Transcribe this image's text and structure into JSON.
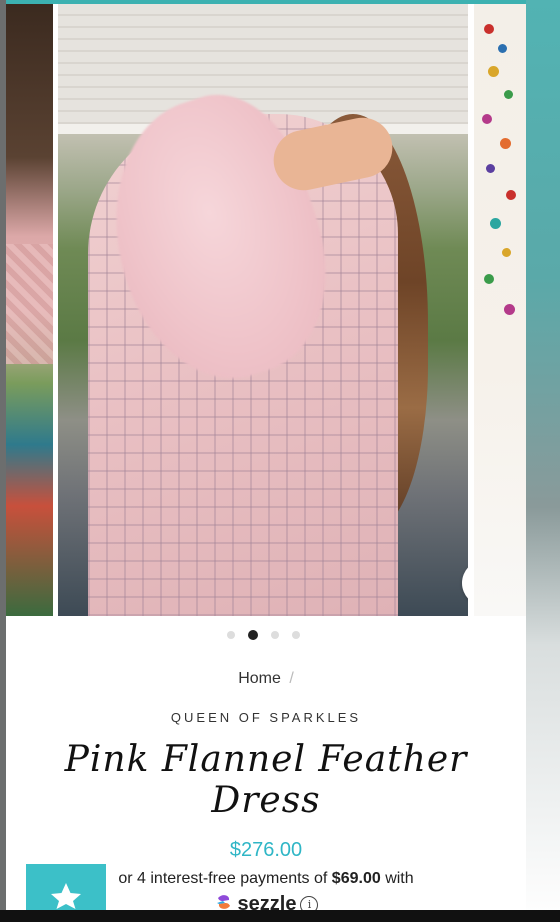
{
  "product": {
    "breadcrumb_home": "Home",
    "breadcrumb_separator": "/",
    "vendor": "QUEEN OF SPARKLES",
    "title": "Pink Flannel Feather Dress",
    "price": "$276.00",
    "installments_prefix": "or 4 interest-free payments of",
    "installments_amount": "$69.00",
    "installments_suffix": "with",
    "payment_brand": "sezzle"
  },
  "carousel": {
    "slide_count": 4,
    "active_index": 1
  },
  "colors": {
    "accent": "#3cc0c8",
    "price": "#2fb6c6"
  },
  "icons": {
    "zoom": "magnifier-icon",
    "info": "info-icon",
    "favorite": "star-icon",
    "brand": "sezzle-logo-icon"
  }
}
